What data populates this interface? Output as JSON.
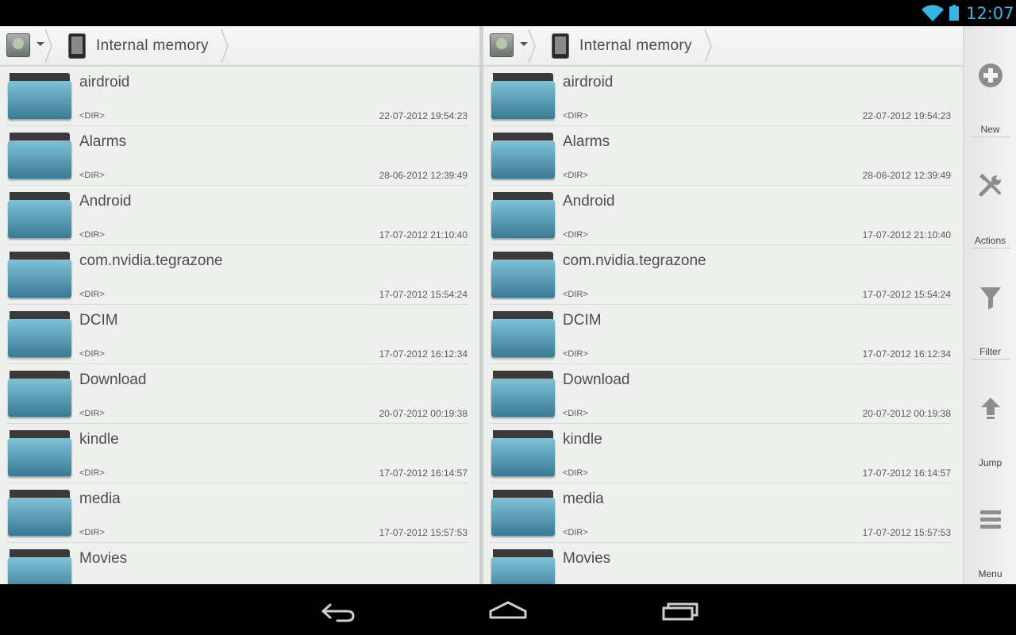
{
  "status_bar": {
    "time": "12:07",
    "accent_color": "#33b5e5"
  },
  "panels": [
    {
      "breadcrumb": {
        "storage_icon": "storage-icon",
        "location": "Internal memory"
      },
      "files": [
        {
          "name": "airdroid",
          "type": "<DIR>",
          "date": "22-07-2012 19:54:23"
        },
        {
          "name": "Alarms",
          "type": "<DIR>",
          "date": "28-06-2012 12:39:49"
        },
        {
          "name": "Android",
          "type": "<DIR>",
          "date": "17-07-2012 21:10:40"
        },
        {
          "name": "com.nvidia.tegrazone",
          "type": "<DIR>",
          "date": "17-07-2012 15:54:24"
        },
        {
          "name": "DCIM",
          "type": "<DIR>",
          "date": "17-07-2012 16:12:34"
        },
        {
          "name": "Download",
          "type": "<DIR>",
          "date": "20-07-2012 00:19:38"
        },
        {
          "name": "kindle",
          "type": "<DIR>",
          "date": "17-07-2012 16:14:57"
        },
        {
          "name": "media",
          "type": "<DIR>",
          "date": "17-07-2012 15:57:53"
        },
        {
          "name": "Movies",
          "type": "",
          "date": ""
        }
      ]
    },
    {
      "breadcrumb": {
        "storage_icon": "storage-icon",
        "location": "Internal memory"
      },
      "files": [
        {
          "name": "airdroid",
          "type": "<DIR>",
          "date": "22-07-2012 19:54:23"
        },
        {
          "name": "Alarms",
          "type": "<DIR>",
          "date": "28-06-2012 12:39:49"
        },
        {
          "name": "Android",
          "type": "<DIR>",
          "date": "17-07-2012 21:10:40"
        },
        {
          "name": "com.nvidia.tegrazone",
          "type": "<DIR>",
          "date": "17-07-2012 15:54:24"
        },
        {
          "name": "DCIM",
          "type": "<DIR>",
          "date": "17-07-2012 16:12:34"
        },
        {
          "name": "Download",
          "type": "<DIR>",
          "date": "20-07-2012 00:19:38"
        },
        {
          "name": "kindle",
          "type": "<DIR>",
          "date": "17-07-2012 16:14:57"
        },
        {
          "name": "media",
          "type": "<DIR>",
          "date": "17-07-2012 15:57:53"
        },
        {
          "name": "Movies",
          "type": "",
          "date": ""
        }
      ]
    }
  ],
  "toolbar": {
    "items": [
      {
        "label": "New",
        "icon": "add-circle-icon"
      },
      {
        "label": "Actions",
        "icon": "tools-icon"
      },
      {
        "label": "Filter",
        "icon": "filter-icon"
      },
      {
        "label": "Jump",
        "icon": "up-arrow-icon"
      },
      {
        "label": "Menu",
        "icon": "menu-icon"
      }
    ]
  },
  "navigation": {
    "buttons": [
      "back-icon",
      "home-icon",
      "recents-icon"
    ]
  }
}
